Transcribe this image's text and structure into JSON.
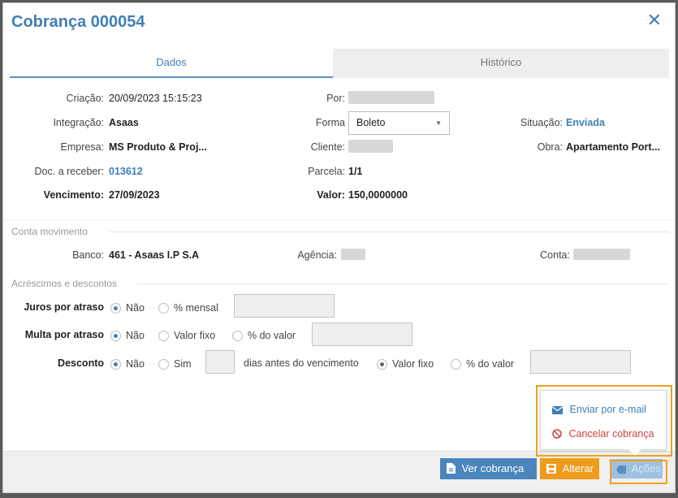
{
  "dialog": {
    "title": "Cobrança 000054",
    "close_icon": "close-icon"
  },
  "tabs": [
    {
      "label": "Dados",
      "active": true
    },
    {
      "label": "Histórico",
      "active": false
    }
  ],
  "fields": {
    "criacao": {
      "label": "Criação:",
      "value": "20/09/2023 15:15:23"
    },
    "por": {
      "label": "Por:"
    },
    "integracao": {
      "label": "Integração:",
      "value": "Asaas"
    },
    "forma": {
      "label": "Forma",
      "value": "Boleto"
    },
    "situacao": {
      "label": "Situação:",
      "value": "Enviada"
    },
    "empresa": {
      "label": "Empresa:",
      "value": "MS Produto & Proj..."
    },
    "cliente": {
      "label": "Cliente:"
    },
    "obra": {
      "label": "Obra:",
      "value": "Apartamento Port..."
    },
    "doc": {
      "label": "Doc. a receber:",
      "value": "013612"
    },
    "parcela": {
      "label": "Parcela:",
      "value": "1/1"
    },
    "vencimento": {
      "label": "Vencimento:",
      "value": "27/09/2023"
    },
    "valor": {
      "label": "Valor:",
      "value": "150,0000000"
    }
  },
  "conta": {
    "section": "Conta movimento",
    "banco_label": "Banco:",
    "banco_value": "461 - Asaas I.P S.A",
    "agencia_label": "Agência:",
    "conta_label": "Conta:"
  },
  "acrescimos": {
    "section": "Acréscimos e descontos",
    "juros_label": "Juros por atraso",
    "multa_label": "Multa por atraso",
    "desconto_label": "Desconto",
    "nao": "Não",
    "mensal": "% mensal",
    "valor_fixo": "Valor fixo",
    "do_valor": "% do valor",
    "sim": "Sim",
    "dias_antes": "dias antes do vencimento"
  },
  "menu": {
    "enviar": "Enviar por e-mail",
    "cancelar": "Cancelar cobrança"
  },
  "footer": {
    "ver": "Ver cobrança",
    "alterar": "Alterar",
    "acoes": "Ações"
  },
  "colors": {
    "accent": "#3f7fb5",
    "orange": "#ef9b1c",
    "danger": "#d04040"
  }
}
